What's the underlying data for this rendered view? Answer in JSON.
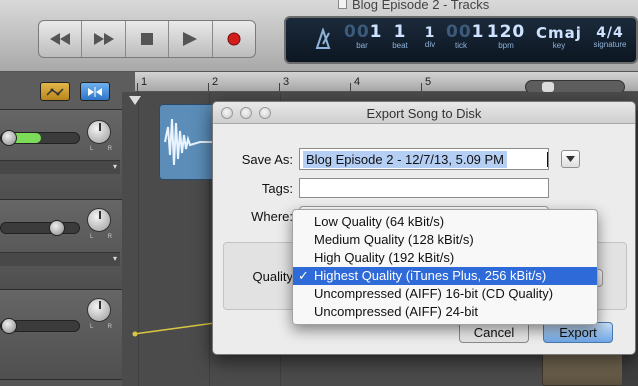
{
  "window": {
    "title": "Blog Episode 2 - Tracks"
  },
  "transport": {
    "buttons": [
      "rewind",
      "fast-forward",
      "stop",
      "play",
      "record"
    ]
  },
  "lcd": {
    "bar": {
      "value": "1",
      "label": "bar"
    },
    "beat": {
      "value": "1",
      "label": "beat"
    },
    "div": {
      "value": "1",
      "label": "div"
    },
    "tick": {
      "value": "1",
      "label": "tick"
    },
    "bpm": {
      "value": "120",
      "label": "bpm"
    },
    "key": {
      "value": "Cmaj",
      "label": "key"
    },
    "signature": {
      "value": "4/4",
      "label": "signature"
    }
  },
  "ruler": {
    "ticks": [
      "1",
      "2",
      "3",
      "4",
      "5"
    ]
  },
  "dialog": {
    "title": "Export Song to Disk",
    "save_as_label": "Save As:",
    "save_as_value": "Blog Episode 2 - 12/7/13, 5.09 PM",
    "tags_label": "Tags:",
    "tags_value": "",
    "where_label": "Where:",
    "quality_label": "Quality",
    "cancel_label": "Cancel",
    "export_label": "Export"
  },
  "quality_menu": {
    "items": [
      "Low Quality (64 kBit/s)",
      "Medium Quality (128 kBit/s)",
      "High Quality (192 kBit/s)",
      "Highest Quality (iTunes Plus, 256 kBit/s)",
      "Uncompressed (AIFF) 16-bit (CD Quality)",
      "Uncompressed (AIFF) 24-bit"
    ],
    "selected_index": 3,
    "check_mark": "✓"
  },
  "colors": {
    "menu_highlight": "#2f6ad9",
    "export_button": "#6fa6e6",
    "region": "#5b8db8",
    "volume_fill": "#7cdb58",
    "lcd_background": "#0c1622"
  }
}
